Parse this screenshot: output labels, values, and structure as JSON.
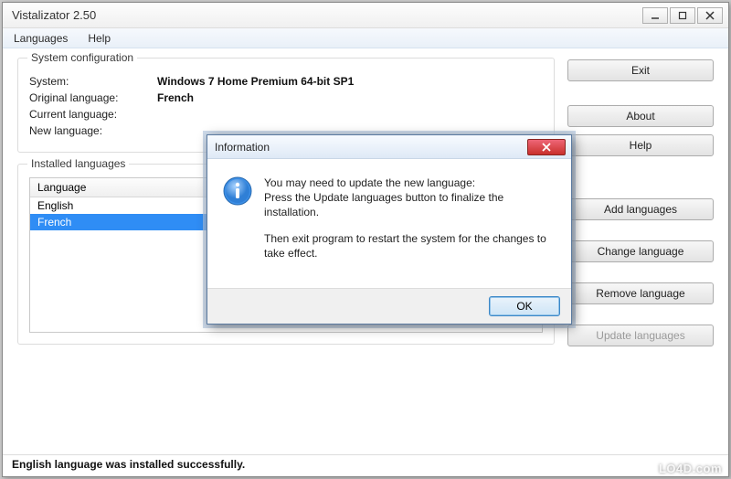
{
  "window": {
    "title": "Vistalizator 2.50"
  },
  "menu": {
    "languages": "Languages",
    "help": "Help"
  },
  "sysconf": {
    "legend": "System configuration",
    "system_label": "System:",
    "system_value": "Windows 7 Home Premium 64-bit SP1",
    "orig_label": "Original language:",
    "orig_value": "French",
    "curr_label": "Current language:",
    "curr_value": "",
    "new_label": "New language:",
    "new_value": ""
  },
  "installed": {
    "legend": "Installed languages",
    "header": "Language",
    "items": [
      "English",
      "French"
    ],
    "selected_index": 1
  },
  "buttons": {
    "exit": "Exit",
    "about": "About",
    "help": "Help",
    "add_languages": "Add languages",
    "change_language": "Change language",
    "remove_language": "Remove language",
    "update_languages": "Update languages"
  },
  "status": "English language was installed successfully.",
  "dialog": {
    "title": "Information",
    "para1": "You may need to update the new language:\nPress the Update languages button to finalize the installation.",
    "para2": "Then exit program to restart the system for the changes to take effect.",
    "ok": "OK"
  },
  "watermark": "LO4D.com"
}
